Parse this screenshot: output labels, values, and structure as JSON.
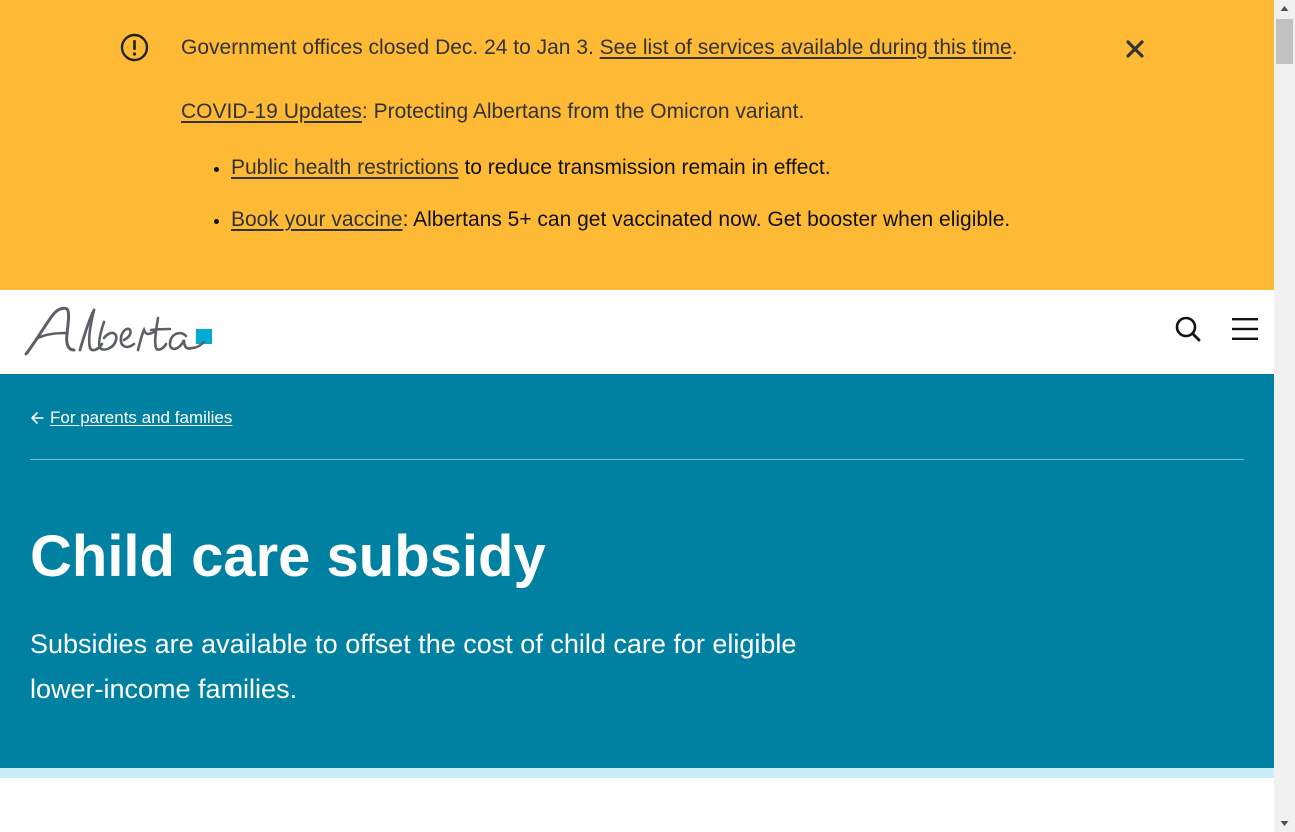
{
  "alert": {
    "line1_text": "Government offices closed Dec. 24 to Jan 3. ",
    "line1_link": "See list of services available during this time",
    "line1_end": ".",
    "covid_link": "COVID-19 Updates",
    "covid_text": ": Protecting Albertans from the Omicron variant.",
    "bullets": [
      {
        "link": "Public health restrictions",
        "text": " to reduce transmission remain in effect."
      },
      {
        "link": "Book your vaccine",
        "text": ": Albertans 5+ can get vaccinated now. Get booster when eligible."
      }
    ],
    "icons": {
      "alert": "alert-circle-icon",
      "close": "close-icon"
    },
    "background": "#FEBA35"
  },
  "header": {
    "logo_text": "Alberta",
    "icons": {
      "search": "search-icon",
      "menu": "hamburger-menu-icon"
    }
  },
  "hero": {
    "back_link": "For parents and families",
    "title": "Child care subsidy",
    "lead": "Subsidies are available to offset the cost of child care for eligible lower-income families.",
    "background": "#0081A2",
    "accent_strip": "#C8EEFA"
  }
}
